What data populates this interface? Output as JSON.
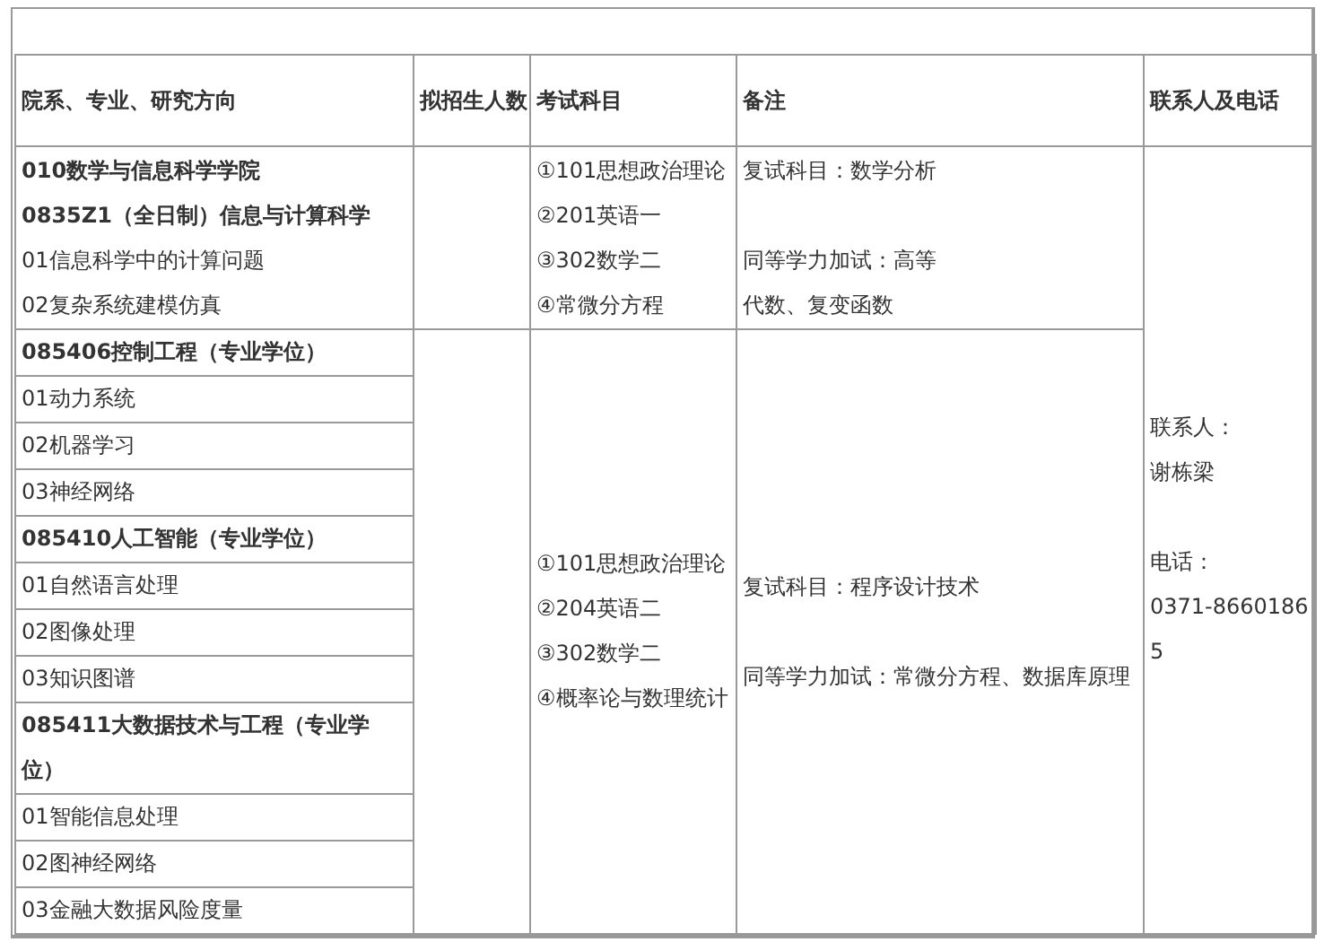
{
  "table": {
    "columns": [
      "院系、专业、研究方向",
      "拟招生人数",
      "考试科目",
      "备注",
      "联系人及电话"
    ],
    "groups": [
      {
        "rows": [
          {
            "lines": [
              {
                "text": "010数学与信息科学学院",
                "kind": "heading"
              },
              {
                "text": "0835Z1（全日制）信息与计算科学",
                "kind": "heading"
              },
              {
                "text": "01信息科学中的计算问题",
                "kind": "item"
              },
              {
                "text": "02复杂系统建模仿真",
                "kind": "item"
              }
            ]
          }
        ],
        "exam_subjects": [
          "①101思想政治理论",
          "②201英语一",
          "③302数学二",
          "④常微分方程"
        ],
        "remarks": [
          [
            "复试科目：数学分析"
          ],
          [
            "同等学力加试：高等",
            "代数、复变函数"
          ]
        ]
      },
      {
        "rows": [
          {
            "lines": [
              {
                "text": "085406控制工程（专业学位）",
                "kind": "heading"
              }
            ]
          },
          {
            "lines": [
              {
                "text": "01动力系统",
                "kind": "item"
              }
            ]
          },
          {
            "lines": [
              {
                "text": "02机器学习",
                "kind": "item"
              }
            ]
          },
          {
            "lines": [
              {
                "text": "03神经网络",
                "kind": "item"
              }
            ]
          },
          {
            "lines": [
              {
                "text": "085410人工智能（专业学位）",
                "kind": "heading"
              }
            ]
          },
          {
            "lines": [
              {
                "text": "01自然语言处理",
                "kind": "item"
              }
            ]
          },
          {
            "lines": [
              {
                "text": "02图像处理",
                "kind": "item"
              }
            ]
          },
          {
            "lines": [
              {
                "text": "03知识图谱",
                "kind": "item"
              }
            ]
          },
          {
            "lines": [
              {
                "text": "085411大数据技术与工程（专业学位）",
                "kind": "heading"
              }
            ]
          },
          {
            "lines": [
              {
                "text": "01智能信息处理",
                "kind": "item"
              }
            ]
          },
          {
            "lines": [
              {
                "text": "02图神经网络",
                "kind": "item"
              }
            ]
          },
          {
            "lines": [
              {
                "text": "03金融大数据风险度量",
                "kind": "item"
              }
            ]
          }
        ],
        "exam_subjects": [
          "①101思想政治理论",
          "②204英语二",
          "③302数学二",
          "④概率论与数理统计"
        ],
        "remarks": [
          [
            "复试科目：程序设计技术"
          ],
          [
            "同等学力加试：常微分方程、数据库原理"
          ]
        ]
      }
    ],
    "contact": [
      [
        "联系人：",
        "谢栋梁"
      ],
      [
        "电话：",
        "0371-86601865"
      ]
    ]
  }
}
